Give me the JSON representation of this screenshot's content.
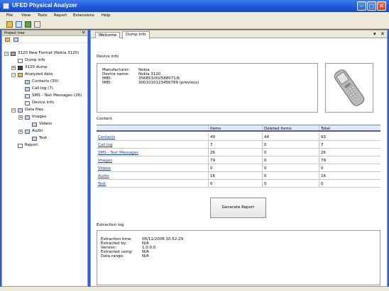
{
  "window": {
    "title": "UFED Physical Analyzer"
  },
  "menu": [
    "File",
    "View",
    "Tools",
    "Report",
    "Extensions",
    "Help"
  ],
  "project_tree": {
    "header": "Project tree",
    "root": "3120 New Format (Nokia 3120)",
    "nodes": [
      {
        "label": "Dump info",
        "icon": "dump-info-icon"
      },
      {
        "label": "3120 dump",
        "icon": "dump-icon"
      },
      {
        "label": "Analyzed data",
        "icon": "analyzed-data-icon"
      },
      {
        "label": "Contacts (30)",
        "icon": "contacts-icon"
      },
      {
        "label": "Call log (7)",
        "icon": "call-log-icon"
      },
      {
        "label": "SMS - Text Messages (26)",
        "icon": "sms-icon"
      },
      {
        "label": "Device info",
        "icon": "device-info-icon"
      },
      {
        "label": "Data files",
        "icon": "data-files-icon"
      },
      {
        "label": "Images",
        "icon": "images-icon"
      },
      {
        "label": "Videos",
        "icon": "videos-icon"
      },
      {
        "label": "Audio",
        "icon": "audio-icon"
      },
      {
        "label": "Text",
        "icon": "text-icon"
      },
      {
        "label": "Report",
        "icon": "report-icon"
      }
    ]
  },
  "tabs": [
    {
      "label": "Welcome",
      "active": false
    },
    {
      "label": "Dump info",
      "active": true
    }
  ],
  "device_info": {
    "section_label": "Device info",
    "rows": [
      {
        "key": "Manufacturer:",
        "value": "Nokia"
      },
      {
        "key": "Device name:",
        "value": "Nokia 3120"
      },
      {
        "key": "IMEI:",
        "value": "356853/00/588071/6"
      },
      {
        "key": "IMEI:",
        "value": "3001010123456789 (previous)"
      }
    ]
  },
  "content": {
    "section_label": "Content",
    "columns": [
      "",
      "Items",
      "Deleted Items",
      "Total"
    ],
    "rows": [
      {
        "name": "Contacts",
        "items": "49",
        "deleted": "44",
        "total": "93"
      },
      {
        "name": "Call log",
        "items": "7",
        "deleted": "0",
        "total": "7"
      },
      {
        "name": "SMS - Text Messages",
        "items": "26",
        "deleted": "0",
        "total": "26"
      },
      {
        "name": "Images",
        "items": "79",
        "deleted": "0",
        "total": "79"
      },
      {
        "name": "Videos",
        "items": "0",
        "deleted": "0",
        "total": "0"
      },
      {
        "name": "Audio",
        "items": "16",
        "deleted": "0",
        "total": "16"
      },
      {
        "name": "Text",
        "items": "0",
        "deleted": "0",
        "total": "0"
      }
    ]
  },
  "generate_report_label": "Generate Report",
  "extraction_log": {
    "section_label": "Extraction log",
    "rows": [
      {
        "key": "Extraction time:",
        "value": "06/11/2008 10:52:29"
      },
      {
        "key": "Extracted by:",
        "value": "N/A"
      },
      {
        "key": "Version:",
        "value": "1.0.0.0"
      },
      {
        "key": "Extracted using:",
        "value": "N/A"
      },
      {
        "key": "Data range:",
        "value": "N/A"
      }
    ]
  },
  "colors": {
    "titlebar": "#1f57d6",
    "chrome": "#ece9d8",
    "link": "#1a3fa0",
    "table_header_border": "#4a5aa0"
  }
}
